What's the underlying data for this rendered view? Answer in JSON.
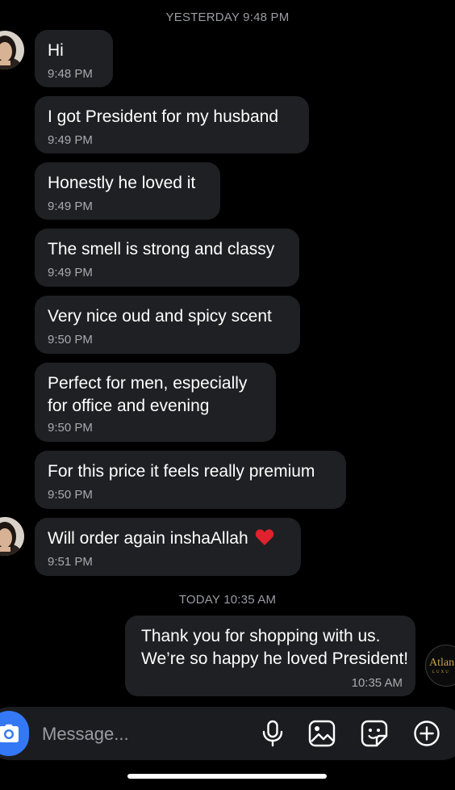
{
  "thread": {
    "divider_yesterday": "YESTERDAY 9:48 PM",
    "divider_today": "TODAY 10:35 AM",
    "incoming": [
      {
        "text": "Hi",
        "time": "9:48 PM"
      },
      {
        "text": "I got President for my husband",
        "time": "9:49 PM"
      },
      {
        "text": "Honestly he loved it",
        "time": "9:49 PM"
      },
      {
        "text": "The smell is strong and classy",
        "time": "9:49 PM"
      },
      {
        "text": "Very nice oud and spicy scent",
        "time": "9:50 PM"
      },
      {
        "text": "Perfect for men, especially\nfor office and evening",
        "time": "9:50 PM"
      },
      {
        "text": "For this price it feels really premium",
        "time": "9:50 PM"
      },
      {
        "text": "Will order again inshaAllah",
        "time": "9:51 PM"
      }
    ],
    "outgoing": [
      {
        "text": "Thank you for shopping with us.\nWe’re so happy he loved President!",
        "time": "10:35 AM"
      }
    ]
  },
  "brand_avatar": {
    "line1": "Atlan",
    "line2": "LUXU"
  },
  "composer": {
    "placeholder": "Message..."
  },
  "icons": {
    "camera": "camera-icon",
    "microphone": "microphone-icon",
    "gallery": "gallery-icon",
    "sticker": "sticker-icon",
    "add": "plus-circle-icon",
    "heart": "red-heart-emoji"
  },
  "colors": {
    "background": "#000000",
    "bubble": "#1f2023",
    "accent": "#3478f6",
    "heart": "#e0212e",
    "timestamp": "#a8aab0"
  }
}
